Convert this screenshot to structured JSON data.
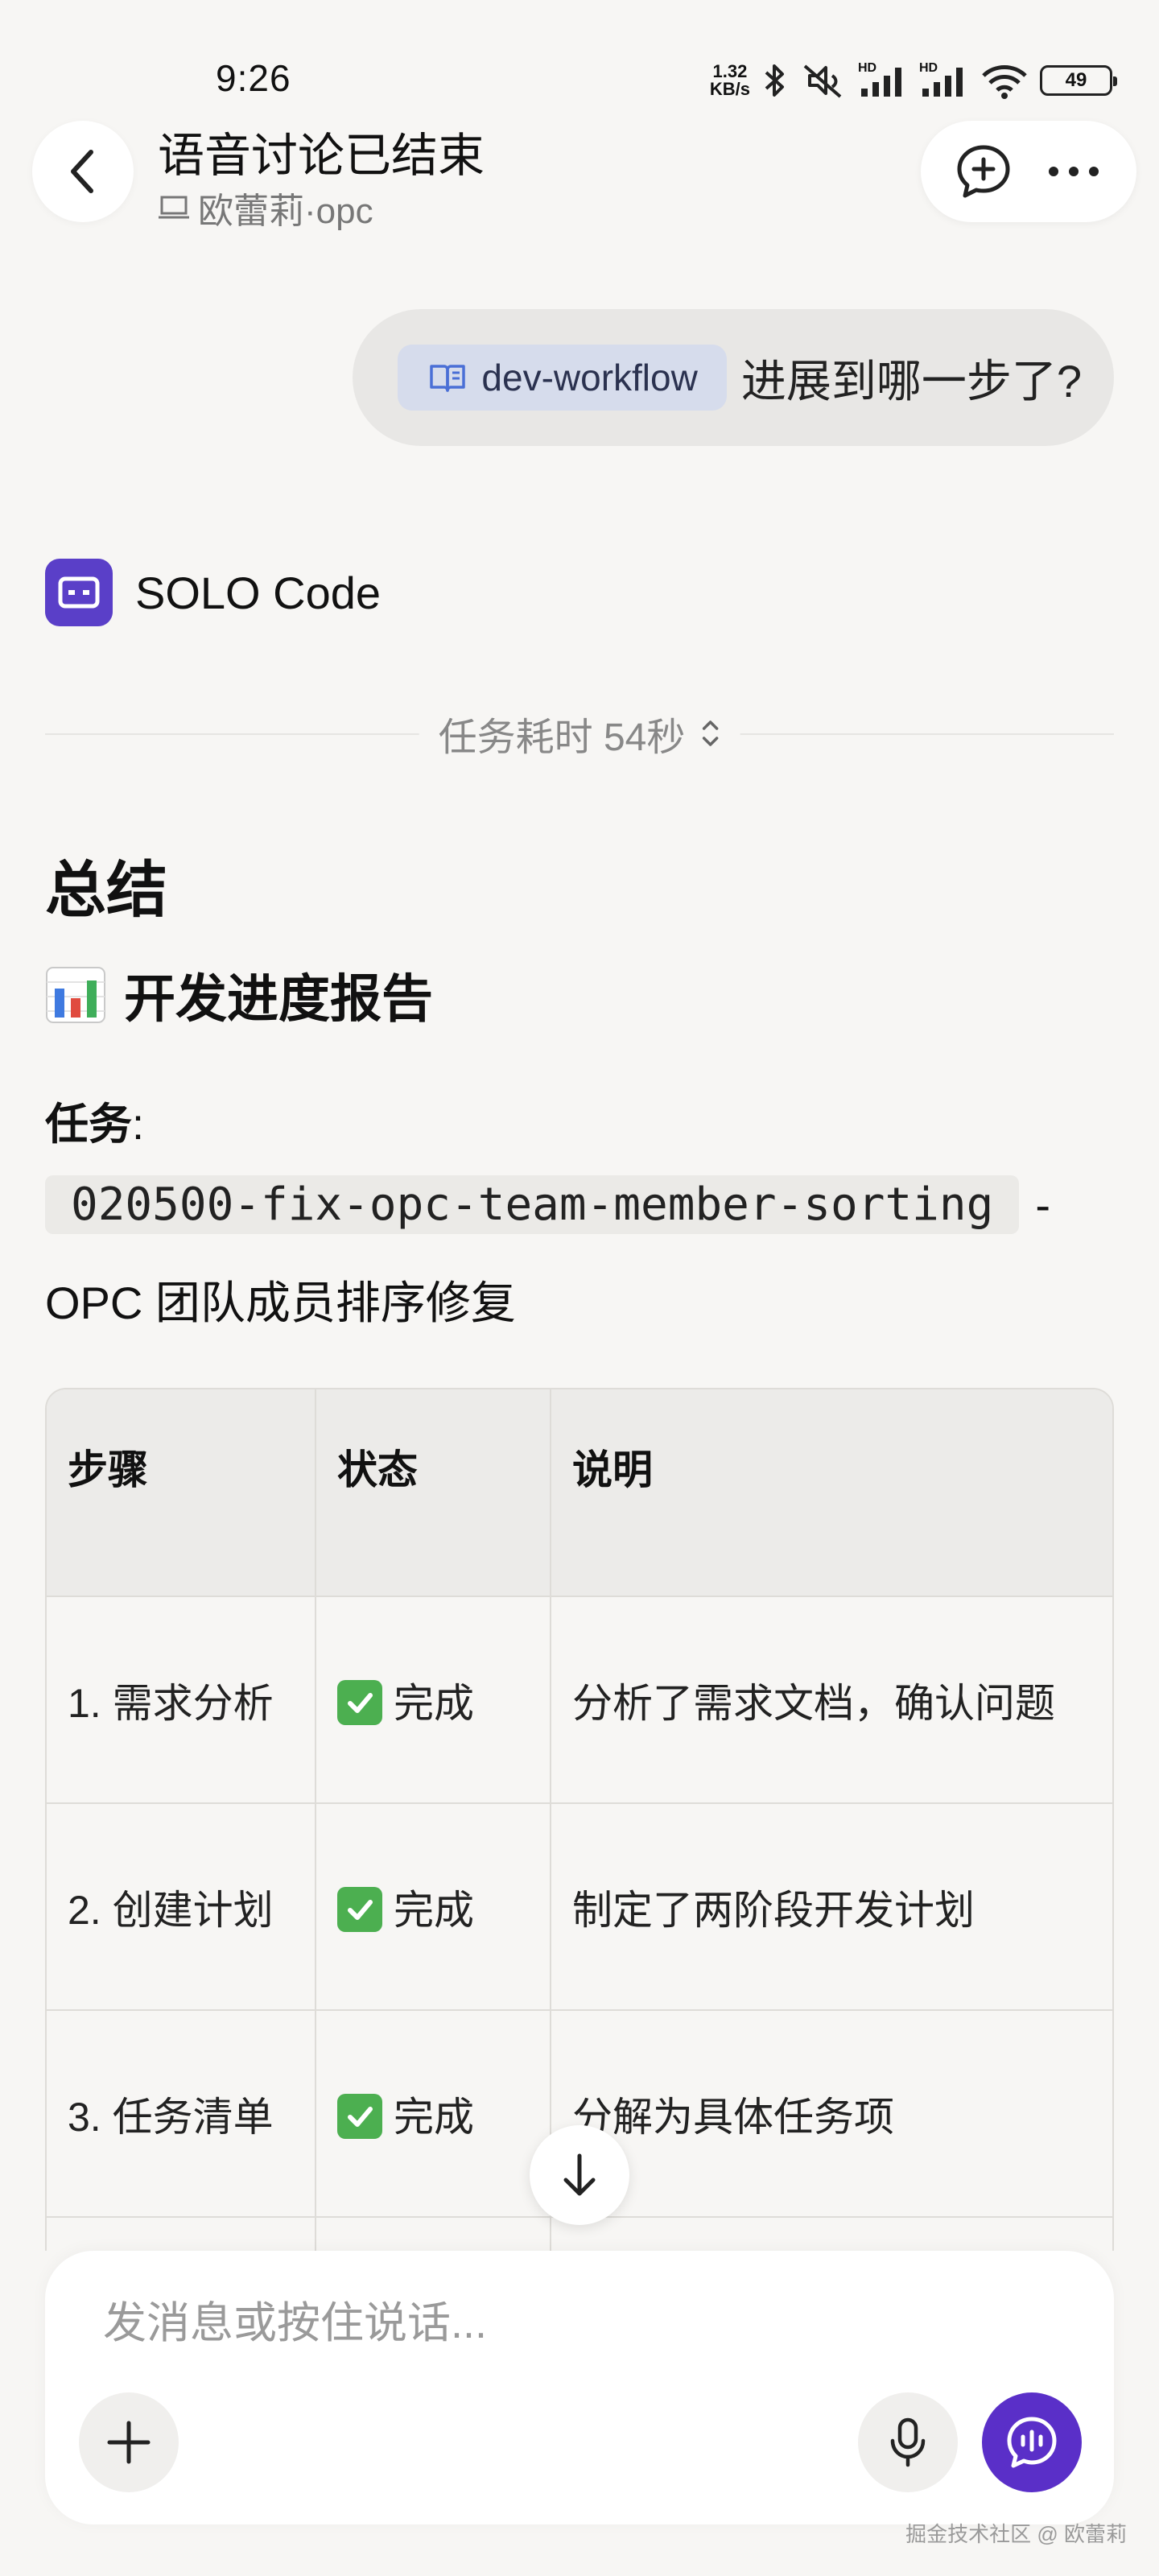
{
  "status_bar": {
    "time": "9:26",
    "net_speed_value": "1.32",
    "net_speed_unit": "KB/s",
    "network_1": "HD",
    "network_2": "HD",
    "battery": "49"
  },
  "header": {
    "title": "语音讨论已结束",
    "subtitle": "欧蕾莉·opc"
  },
  "user_message": {
    "skill_chip": "dev-workflow",
    "text": "进展到哪一步了?"
  },
  "agent": {
    "name": "SOLO Code",
    "duration": "任务耗时 54秒"
  },
  "content": {
    "summary_heading": "总结",
    "report_heading": "开发进度报告",
    "task_label": "任务",
    "task_colon": ":",
    "task_code": "020500-fix-opc-team-member-sorting",
    "task_dash": "-",
    "task_desc": "OPC 团队成员排序修复"
  },
  "table": {
    "headers": [
      "步骤",
      "状态",
      "说明"
    ],
    "rows": [
      {
        "step": "1. 需求分析",
        "status": "完成",
        "desc": "分析了需求文档，确认问题"
      },
      {
        "step": "2. 创建计划",
        "status": "完成",
        "desc": "制定了两阶段开发计划"
      },
      {
        "step": "3. 任务清单",
        "status": "完成",
        "desc": "分解为具体任务项"
      }
    ]
  },
  "composer": {
    "placeholder": "发消息或按住说话..."
  },
  "watermark": "掘金技术社区 @ 欧蕾莉",
  "colors": {
    "accent": "#5a2fc8",
    "agent_avatar": "#5a3fc8",
    "chip_bg": "#d6dcec",
    "check_green": "#4caf50"
  },
  "icons": {
    "back": "chevron-left-icon",
    "new_chat": "chat-plus-icon",
    "more": "more-dots-icon",
    "skill": "book-icon",
    "agent": "solo-code-icon",
    "duration": "expand-updown-icon",
    "report": "bar-chart-emoji-icon",
    "status_done": "check-mark-icon",
    "scroll": "arrow-down-icon",
    "add": "plus-icon",
    "mic": "microphone-icon",
    "voice": "voice-chat-icon"
  }
}
